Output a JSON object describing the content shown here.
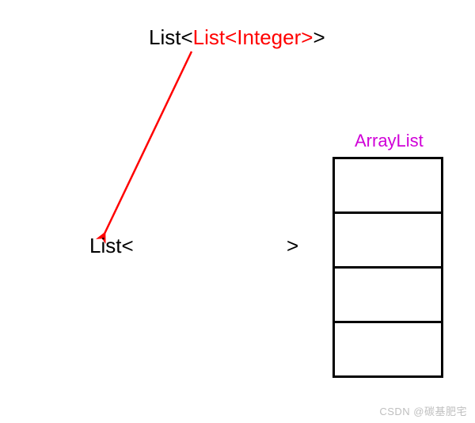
{
  "top_type": {
    "outer_prefix": "List<",
    "inner": "List<Integer>",
    "outer_suffix": ">"
  },
  "bottom_type": {
    "left": "List<",
    "right": ">"
  },
  "arraylist_label": "ArrayList",
  "watermark": "CSDN @碳基肥宅",
  "colors": {
    "red": "#ff0000",
    "black": "#000000",
    "magenta": "#d000d8"
  },
  "array_cell_count": 4
}
